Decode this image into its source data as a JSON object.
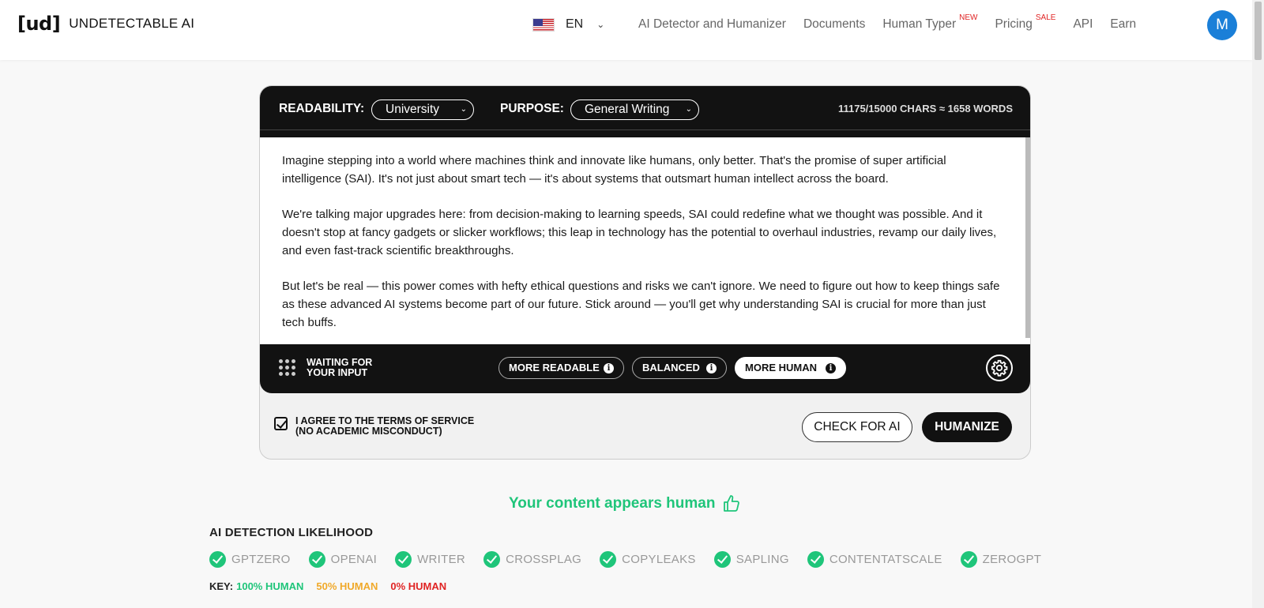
{
  "header": {
    "logo_mark": "[ud]",
    "logo_text": "UNDETECTABLE AI",
    "language": "EN",
    "nav": [
      {
        "label": "AI Detector and Humanizer",
        "badge": ""
      },
      {
        "label": "Documents",
        "badge": ""
      },
      {
        "label": "Human Typer",
        "badge": "NEW"
      },
      {
        "label": "Pricing",
        "badge": "SALE"
      },
      {
        "label": "API",
        "badge": ""
      },
      {
        "label": "Earn",
        "badge": ""
      }
    ],
    "avatar_initial": "M"
  },
  "editor": {
    "readability_label": "READABILITY:",
    "readability_value": "University",
    "purpose_label": "PURPOSE:",
    "purpose_value": "General Writing",
    "char_count": "11175/15000 CHARS ≈ 1658 WORDS",
    "paragraphs": [
      "Imagine stepping into a world where machines think and innovate like humans, only better. That's the promise of super artificial intelligence (SAI). It's not just about smart tech — it's about systems that outsmart human intellect across the board.",
      "We're talking major upgrades here: from decision-making to learning speeds, SAI could redefine what we thought was possible. And it doesn't stop at fancy gadgets or slicker workflows; this leap in technology has the potential to overhaul industries, revamp our daily lives, and even fast-track scientific breakthroughs.",
      "But let's be real — this power comes with hefty ethical questions and risks we can't ignore. We need to figure out how to keep things safe as these advanced AI systems become part of our future. Stick around — you'll get why understanding SAI is crucial for more than just tech buffs."
    ],
    "status": "WAITING FOR YOUR INPUT",
    "modes": [
      {
        "label": "MORE READABLE",
        "active": false
      },
      {
        "label": "BALANCED",
        "active": false
      },
      {
        "label": "MORE HUMAN",
        "active": true
      }
    ],
    "agree_text": "I AGREE TO THE TERMS OF SERVICE (NO ACADEMIC MISCONDUCT)",
    "check_button": "CHECK FOR AI",
    "humanize_button": "HUMANIZE"
  },
  "results": {
    "headline": "Your content appears human",
    "detection_title": "AI DETECTION LIKELIHOOD",
    "detectors": [
      "GPTZERO",
      "OPENAI",
      "WRITER",
      "CROSSPLAG",
      "COPYLEAKS",
      "SAPLING",
      "CONTENTATSCALE",
      "ZEROGPT"
    ],
    "key_label": "KEY:",
    "key": [
      {
        "label": "100% HUMAN",
        "color": "#1fc57a"
      },
      {
        "label": "50% HUMAN",
        "color": "#f0a92a"
      },
      {
        "label": "0% HUMAN",
        "color": "#e02424"
      }
    ]
  },
  "colors": {
    "accent_green": "#1fc57a",
    "avatar_blue": "#1a7fd8",
    "badge_red": "#e02424"
  }
}
